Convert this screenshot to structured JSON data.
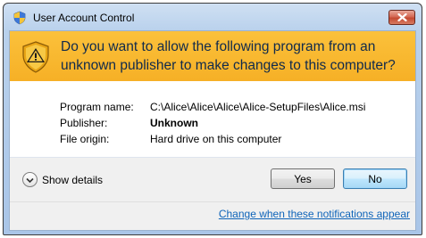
{
  "window": {
    "title": "User Account Control",
    "title_icon": "uac-shield-icon",
    "close_icon": "close-icon"
  },
  "banner": {
    "icon": "warning-shield-icon",
    "question": "Do you want to allow the following program from an unknown publisher to make changes to this computer?",
    "background_color": "#f6b026"
  },
  "details": {
    "program_name_label": "Program name:",
    "program_name_value": "C:\\Alice\\Alice\\Alice\\Alice-SetupFiles\\Alice.msi",
    "publisher_label": "Publisher:",
    "publisher_value": "Unknown",
    "file_origin_label": "File origin:",
    "file_origin_value": "Hard drive on this computer"
  },
  "footer": {
    "show_details_label": "Show details",
    "yes_label": "Yes",
    "no_label": "No",
    "notifications_link": "Change when these notifications appear",
    "link_color": "#0e64b9"
  }
}
